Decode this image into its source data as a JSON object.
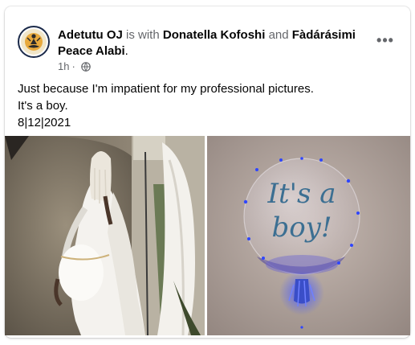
{
  "post": {
    "author": "Adetutu OJ",
    "connector_is_with": "is with",
    "tagged_1": "Donatella Kofoshi",
    "connector_and": "and",
    "tagged_2": "Fàdárásimi Peace Alabi",
    "period": ".",
    "timestamp": "1h",
    "separator": "·",
    "privacy_icon": "globe-icon",
    "more_icon": "more-options-icon",
    "more_symbol": "•••",
    "caption_lines": [
      "Just because I'm impatient for my professional pictures.",
      "It's a boy.",
      "8|12|2021"
    ]
  },
  "photos": [
    {
      "icon": "maternity-photo-image"
    },
    {
      "icon": "its-a-boy-balloon-image",
      "balloon_text_1": "It's a",
      "balloon_text_2": "boy!"
    }
  ],
  "colors": {
    "name": "#050505",
    "muted": "#65676b",
    "balloon_text": "#3c6f92",
    "led": "#2f46ff"
  }
}
